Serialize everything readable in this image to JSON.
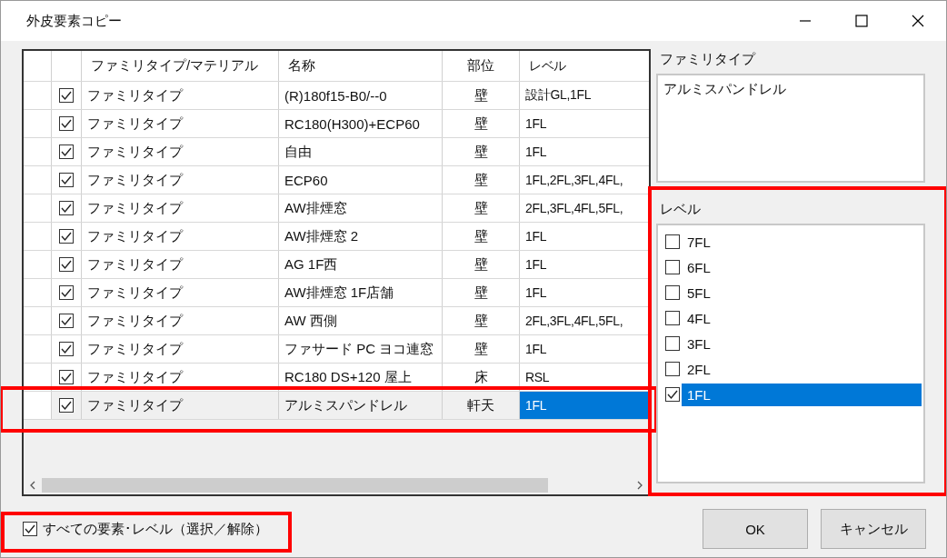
{
  "window": {
    "title": "外皮要素コピー"
  },
  "table": {
    "columns": [
      "ファミリタイプ/マテリアル",
      "名称",
      "部位",
      "レベル"
    ],
    "rows": [
      {
        "checked": true,
        "selected": false,
        "highlighted": false,
        "cells": [
          "ファミリタイプ",
          "(R)180f15-B0/--0",
          "壁",
          "設計GL,1FL"
        ]
      },
      {
        "checked": true,
        "selected": false,
        "highlighted": false,
        "cells": [
          "ファミリタイプ",
          "RC180(H300)+ECP60",
          "壁",
          "1FL"
        ]
      },
      {
        "checked": true,
        "selected": false,
        "highlighted": false,
        "cells": [
          "ファミリタイプ",
          "自由",
          "壁",
          "1FL"
        ]
      },
      {
        "checked": true,
        "selected": false,
        "highlighted": false,
        "cells": [
          "ファミリタイプ",
          "ECP60",
          "壁",
          "1FL,2FL,3FL,4FL,"
        ]
      },
      {
        "checked": true,
        "selected": false,
        "highlighted": false,
        "cells": [
          "ファミリタイプ",
          "AW排煙窓",
          "壁",
          "2FL,3FL,4FL,5FL,"
        ]
      },
      {
        "checked": true,
        "selected": false,
        "highlighted": false,
        "cells": [
          "ファミリタイプ",
          "AW排煙窓 2",
          "壁",
          "1FL"
        ]
      },
      {
        "checked": true,
        "selected": false,
        "highlighted": false,
        "cells": [
          "ファミリタイプ",
          "AG 1F西",
          "壁",
          "1FL"
        ]
      },
      {
        "checked": true,
        "selected": false,
        "highlighted": false,
        "cells": [
          "ファミリタイプ",
          "AW排煙窓 1F店舗",
          "壁",
          "1FL"
        ]
      },
      {
        "checked": true,
        "selected": false,
        "highlighted": false,
        "cells": [
          "ファミリタイプ",
          "AW 西側",
          "壁",
          "2FL,3FL,4FL,5FL,"
        ]
      },
      {
        "checked": true,
        "selected": false,
        "highlighted": false,
        "cells": [
          "ファミリタイプ",
          "ファサード PC ヨコ連窓",
          "壁",
          "1FL"
        ]
      },
      {
        "checked": true,
        "selected": false,
        "highlighted": false,
        "cells": [
          "ファミリタイプ",
          "RC180 DS+120 屋上",
          "床",
          "RSL"
        ]
      },
      {
        "checked": true,
        "selected": true,
        "highlighted": true,
        "cells": [
          "ファミリタイプ",
          "アルミスパンドレル",
          "軒天",
          "1FL"
        ]
      }
    ]
  },
  "family_type": {
    "label": "ファミリタイプ",
    "value": "アルミスパンドレル"
  },
  "levels": {
    "label": "レベル",
    "highlighted": true,
    "items": [
      {
        "label": "7FL",
        "checked": false,
        "selected": false
      },
      {
        "label": "6FL",
        "checked": false,
        "selected": false
      },
      {
        "label": "5FL",
        "checked": false,
        "selected": false
      },
      {
        "label": "4FL",
        "checked": false,
        "selected": false
      },
      {
        "label": "3FL",
        "checked": false,
        "selected": false
      },
      {
        "label": "2FL",
        "checked": false,
        "selected": false
      },
      {
        "label": "1FL",
        "checked": true,
        "selected": true
      }
    ]
  },
  "select_all": {
    "label": "すべての要素･レベル（選択／解除）",
    "checked": true,
    "highlighted": true
  },
  "buttons": [
    "OK",
    "キャンセル"
  ]
}
